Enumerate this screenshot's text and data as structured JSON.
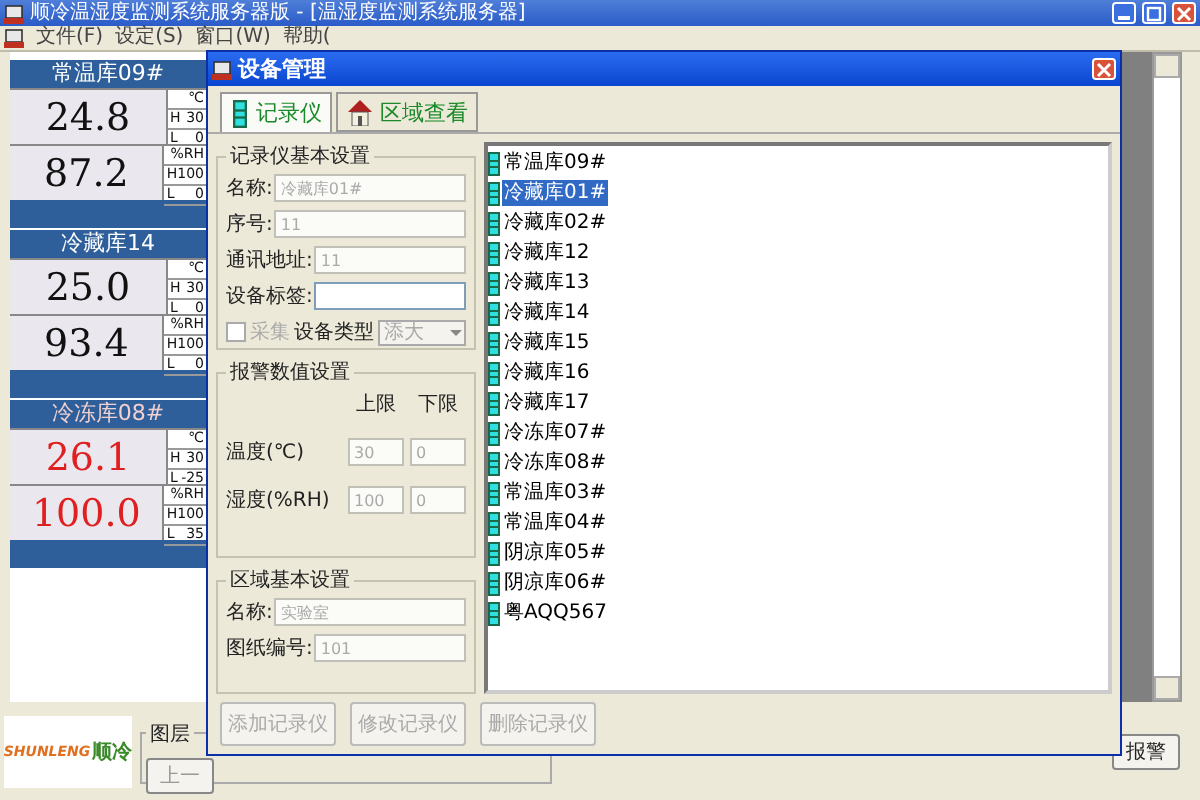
{
  "window": {
    "title": "顺冷温湿度监测系统服务器版 - [温湿度监测系统服务器]"
  },
  "menu": [
    "文件(F)",
    "设定(S)",
    "窗口(W)",
    "帮助("
  ],
  "sensors": [
    {
      "name": "常温库09#",
      "alarm": false,
      "readings": [
        {
          "value": "24.8",
          "unit": "℃",
          "limits": [
            {
              "label": "H",
              "value": "30"
            },
            {
              "label": "L",
              "value": "0"
            }
          ]
        },
        {
          "value": "87.2",
          "unit": "%RH",
          "limits": [
            {
              "label": "H",
              "value": "100"
            },
            {
              "label": "L",
              "value": "0"
            }
          ]
        }
      ]
    },
    {
      "name": "冷藏库14",
      "alarm": false,
      "readings": [
        {
          "value": "25.0",
          "unit": "℃",
          "limits": [
            {
              "label": "H",
              "value": "30"
            },
            {
              "label": "L",
              "value": "0"
            }
          ]
        },
        {
          "value": "93.4",
          "unit": "%RH",
          "limits": [
            {
              "label": "H",
              "value": "100"
            },
            {
              "label": "L",
              "value": "0"
            }
          ]
        }
      ]
    },
    {
      "name": "冷冻库08#",
      "alarm": true,
      "readings": [
        {
          "value": "26.1",
          "unit": "℃",
          "limits": [
            {
              "label": "H",
              "value": "30"
            },
            {
              "label": "L",
              "value": "-25"
            }
          ]
        },
        {
          "value": "100.0",
          "unit": "%RH",
          "limits": [
            {
              "label": "H",
              "value": "100"
            },
            {
              "label": "L",
              "value": "35"
            }
          ]
        }
      ]
    }
  ],
  "bottom": {
    "logo": {
      "latin": "SHUNLENG",
      "chinese": "顺冷"
    },
    "layer_group": {
      "title": "图层",
      "button": "上一"
    },
    "alarm_button": "报警"
  },
  "dialog": {
    "title": "设备管理",
    "tabs": [
      {
        "label": "记录仪",
        "selected": true
      },
      {
        "label": "区域查看",
        "selected": false
      }
    ],
    "recorder_group": {
      "title": "记录仪基本设置",
      "fields": [
        {
          "label": "名称:",
          "value": "冷藏库01#",
          "disabled": true
        },
        {
          "label": "序号:",
          "value": "11",
          "disabled": true
        },
        {
          "label": "通讯地址:",
          "value": "11",
          "disabled": true
        },
        {
          "label": "设备标签:",
          "disabled": false
        }
      ],
      "collect": {
        "label": "采集",
        "checked": false,
        "disabled": true
      },
      "type": {
        "label": "设备类型",
        "value": "添大",
        "disabled": true
      }
    },
    "alarm_group": {
      "title": "报警数值设置",
      "columns": [
        "上限",
        "下限"
      ],
      "rows": [
        {
          "label": "温度(℃)",
          "upper": "30",
          "lower": "0"
        },
        {
          "label": "湿度(%RH)",
          "upper": "100",
          "lower": "0"
        }
      ]
    },
    "area_group": {
      "title": "区域基本设置",
      "fields": [
        {
          "label": "名称:",
          "value": "实验室",
          "disabled": true
        },
        {
          "label": "图纸编号:",
          "value": "101",
          "disabled": true
        }
      ]
    },
    "devices": [
      {
        "name": "常温库09#",
        "selected": false
      },
      {
        "name": "冷藏库01#",
        "selected": true
      },
      {
        "name": "冷藏库02#",
        "selected": false
      },
      {
        "name": "冷藏库12",
        "selected": false
      },
      {
        "name": "冷藏库13",
        "selected": false
      },
      {
        "name": "冷藏库14",
        "selected": false
      },
      {
        "name": "冷藏库15",
        "selected": false
      },
      {
        "name": "冷藏库16",
        "selected": false
      },
      {
        "name": "冷藏库17",
        "selected": false
      },
      {
        "name": "冷冻库07#",
        "selected": false
      },
      {
        "name": "冷冻库08#",
        "selected": false
      },
      {
        "name": "常温库03#",
        "selected": false
      },
      {
        "name": "常温库04#",
        "selected": false
      },
      {
        "name": "阴凉库05#",
        "selected": false
      },
      {
        "name": "阴凉库06#",
        "selected": false
      },
      {
        "name": "粤AQQ567",
        "selected": false
      }
    ],
    "buttons": [
      {
        "label": "添加记录仪",
        "disabled": true
      },
      {
        "label": "修改记录仪",
        "disabled": true
      },
      {
        "label": "删除记录仪",
        "disabled": true
      }
    ]
  }
}
